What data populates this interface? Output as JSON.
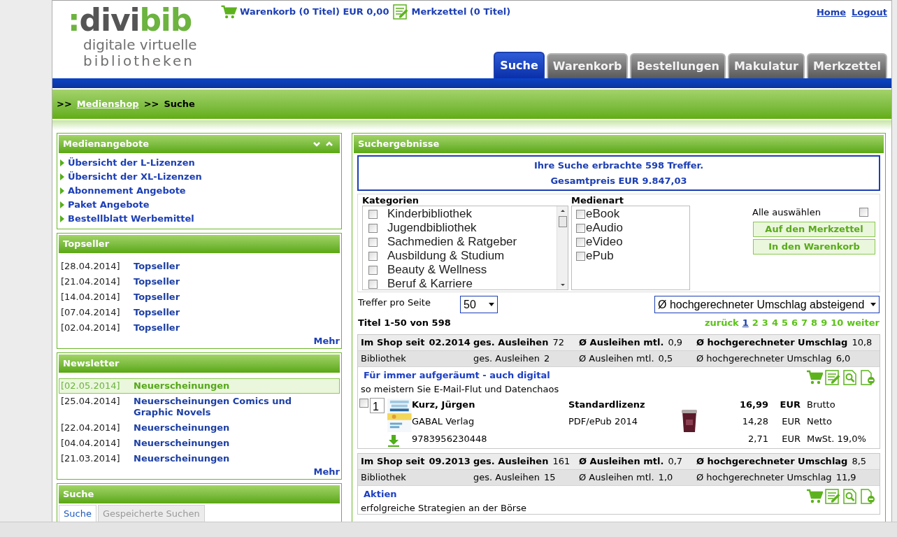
{
  "logo": {
    "parts": [
      ":",
      "divi",
      "bib"
    ],
    "tagline_1": "digitale virtuelle",
    "tagline_2": "bibliotheken"
  },
  "top_links": [
    {
      "kind": "cart",
      "label": "Warenkorb (0 Titel) EUR 0,00"
    },
    {
      "kind": "notepad",
      "label": "Merkzettel (0 Titel)"
    }
  ],
  "account_links": [
    "Home",
    "Logout"
  ],
  "tabs": [
    {
      "label": "Suche",
      "selected": true
    },
    {
      "label": "Warenkorb",
      "selected": false
    },
    {
      "label": "Bestellungen",
      "selected": false
    },
    {
      "label": "Makulatur",
      "selected": false
    },
    {
      "label": "Merkzettel",
      "selected": false
    }
  ],
  "breadcrumb": {
    "sep_1": ">>",
    "link": "Medienshop",
    "sep_2": ">>",
    "current": "Suche"
  },
  "medienangebote": {
    "title": "Medienangebote",
    "items": [
      "Übersicht der L-Lizenzen",
      "Übersicht der XL-Lizenzen",
      "Abonnement Angebote",
      "Paket Angebote",
      "Bestellblatt Werbemittel"
    ]
  },
  "topseller": {
    "title": "Topseller",
    "items": [
      {
        "date": "[28.04.2014]",
        "label": "Topseller",
        "selected": false
      },
      {
        "date": "[21.04.2014]",
        "label": "Topseller",
        "selected": false
      },
      {
        "date": "[14.04.2014]",
        "label": "Topseller",
        "selected": false
      },
      {
        "date": "[07.04.2014]",
        "label": "Topseller",
        "selected": false
      },
      {
        "date": "[02.04.2014]",
        "label": "Topseller",
        "selected": false
      }
    ],
    "more": "Mehr"
  },
  "newsletter": {
    "title": "Newsletter",
    "items": [
      {
        "date": "[02.05.2014]",
        "label": "Neuerscheinungen",
        "selected": true
      },
      {
        "date": "[25.04.2014]",
        "label": "Neuerscheinungen Comics und Graphic Novels",
        "selected": false
      },
      {
        "date": "[22.04.2014]",
        "label": "Neuerscheinungen",
        "selected": false
      },
      {
        "date": "[04.04.2014]",
        "label": "Neuerscheinungen",
        "selected": false
      },
      {
        "date": "[21.03.2014]",
        "label": "Neuerscheinungen",
        "selected": false
      }
    ],
    "more": "Mehr"
  },
  "search_box": {
    "title": "Suche",
    "tabs": [
      {
        "label": "Suche",
        "selected": true
      },
      {
        "label": "Gespeicherte Suchen",
        "selected": false
      }
    ]
  },
  "results": {
    "title": "Suchergebnisse",
    "summary_1": "Ihre Suche erbrachte 598 Treffer.",
    "summary_2": "Gesamtpreis EUR 9.847,03",
    "categories": {
      "label": "Kategorien",
      "items": [
        {
          "label": "Kinderbibliothek",
          "checked": false
        },
        {
          "label": "Jugendbibliothek",
          "checked": false
        },
        {
          "label": "Sachmedien & Ratgeber",
          "checked": false
        },
        {
          "label": "Ausbildung & Studium",
          "checked": false
        },
        {
          "label": "Beauty & Wellness",
          "checked": false
        },
        {
          "label": "Beruf & Karriere",
          "checked": false
        }
      ]
    },
    "media_types": {
      "label": "Medienart",
      "items": [
        {
          "label": "eBook",
          "checked": false
        },
        {
          "label": "eAudio",
          "checked": false
        },
        {
          "label": "eVideo",
          "checked": false
        },
        {
          "label": "ePub",
          "checked": false
        }
      ]
    },
    "select_all": {
      "label": "Alle auswählen",
      "checked": false
    },
    "buttons": [
      "Auf den Merkzettel",
      "In den Warenkorb"
    ],
    "per_page_label": "Treffer pro Seite",
    "per_page": "50",
    "sort": "Ø hochgerechneter Umschlag absteigend",
    "range": "Titel 1-50 von 598",
    "prev": "zurück",
    "pages": [
      {
        "label": "1",
        "selected": true
      },
      {
        "label": "2",
        "selected": false
      },
      {
        "label": "3",
        "selected": false
      },
      {
        "label": "4",
        "selected": false
      },
      {
        "label": "5",
        "selected": false
      },
      {
        "label": "6",
        "selected": false
      },
      {
        "label": "7",
        "selected": false
      },
      {
        "label": "8",
        "selected": false
      },
      {
        "label": "9",
        "selected": false
      },
      {
        "label": "10",
        "selected": false
      }
    ],
    "next": "weiter",
    "items": [
      {
        "shop_stats": [
          {
            "label": "Im Shop seit",
            "value": "02.2014"
          },
          {
            "label": "ges. Ausleihen",
            "value": "72"
          },
          {
            "label": "Ø Ausleihen mtl.",
            "value": "0,9"
          },
          {
            "label": "Ø hochgerechneter Umschlag",
            "value": "10,8"
          }
        ],
        "library_stats": [
          {
            "label": "Bibliothek"
          },
          {
            "label": "ges. Ausleihen",
            "value": "2"
          },
          {
            "label": "Ø Ausleihen mtl.",
            "value": "0,5"
          },
          {
            "label": "Ø hochgerechneter Umschlag",
            "value": "6,0"
          }
        ],
        "title": "Für immer aufgeräumt - auch digital",
        "subtitle": "so meistern Sie E-Mail-Flut und Datenchaos",
        "details": {
          "checked": false,
          "quantity": "1",
          "author": "Kurz, Jürgen",
          "publisher": "GABAL Verlag",
          "isbn": "9783956230448",
          "license": "Standardlizenz",
          "format": "PDF/ePub 2014",
          "prices": [
            {
              "amount": "16,99",
              "currency": "EUR",
              "label": "Brutto"
            },
            {
              "amount": "14,28",
              "currency": "EUR",
              "label": "Netto"
            },
            {
              "amount": "2,71",
              "currency": "EUR",
              "label": "MwSt. 19,0%"
            }
          ]
        }
      },
      {
        "shop_stats": [
          {
            "label": "Im Shop seit",
            "value": "09.2013"
          },
          {
            "label": "ges. Ausleihen",
            "value": "161"
          },
          {
            "label": "Ø Ausleihen mtl.",
            "value": "0,7"
          },
          {
            "label": "Ø hochgerechneter Umschlag",
            "value": "8,5"
          }
        ],
        "library_stats": [
          {
            "label": "Bibliothek"
          },
          {
            "label": "ges. Ausleihen",
            "value": "15"
          },
          {
            "label": "Ø Ausleihen mtl.",
            "value": "1,0"
          },
          {
            "label": "Ø hochgerechneter Umschlag",
            "value": "11,9"
          }
        ],
        "title": "Aktien",
        "subtitle": "erfolgreiche Strategien an der Börse"
      }
    ]
  }
}
